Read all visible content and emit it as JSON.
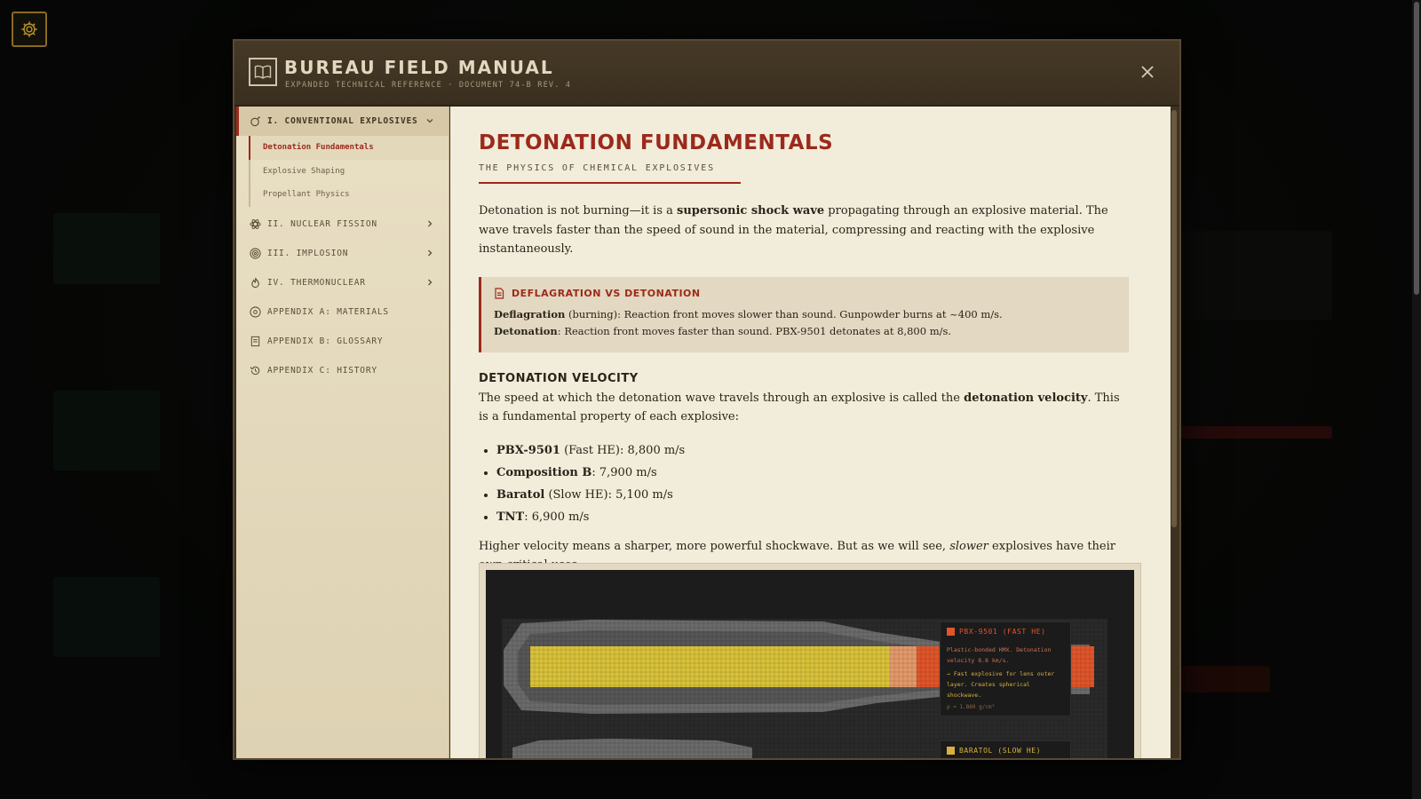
{
  "modal": {
    "title": "BUREAU FIELD MANUAL",
    "subtitle": "EXPANDED TECHNICAL REFERENCE · DOCUMENT 74-B REV. 4"
  },
  "sidebar": {
    "sections": [
      {
        "label": "I. CONVENTIONAL EXPLOSIVES",
        "icon": "bomb-icon",
        "expanded": true,
        "items": [
          "Detonation Fundamentals",
          "Explosive Shaping",
          "Propellant Physics"
        ]
      },
      {
        "label": "II. NUCLEAR FISSION",
        "icon": "atom-icon"
      },
      {
        "label": "III. IMPLOSION",
        "icon": "target-icon"
      },
      {
        "label": "IV. THERMONUCLEAR",
        "icon": "flame-icon"
      },
      {
        "label": "APPENDIX A: MATERIALS",
        "icon": "materials-icon"
      },
      {
        "label": "APPENDIX B: GLOSSARY",
        "icon": "glossary-icon"
      },
      {
        "label": "APPENDIX C: HISTORY",
        "icon": "history-icon"
      }
    ]
  },
  "content": {
    "title": "DETONATION FUNDAMENTALS",
    "subtitle": "THE PHYSICS OF CHEMICAL EXPLOSIVES",
    "intro_a": "Detonation is not burning—it is a ",
    "intro_b": "supersonic shock wave",
    "intro_c": " propagating through an explosive material. The wave travels faster than the speed of sound in the material, compressing and reacting with the explosive instantaneously.",
    "callout": {
      "title": "DEFLAGRATION VS DETONATION",
      "line1_term": "Deflagration",
      "line1_text": " (burning): Reaction front moves slower than sound. Gunpowder burns at ~400 m/s.",
      "line2_term": "Detonation",
      "line2_text": ": Reaction front moves faster than sound. PBX-9501 detonates at 8,800 m/s."
    },
    "velocity_heading": "DETONATION VELOCITY",
    "velocity_a": "The speed at which the detonation wave travels through an explosive is called the ",
    "velocity_b": "detonation velocity",
    "velocity_c": ". This is a fundamental property of each explosive:",
    "velocities": [
      {
        "name": "PBX-9501",
        "text": " (Fast HE): 8,800 m/s"
      },
      {
        "name": "Composition B",
        "text": ": 7,900 m/s"
      },
      {
        "name": "Baratol",
        "text": " (Slow HE): 5,100 m/s"
      },
      {
        "name": "TNT",
        "text": ": 6,900 m/s"
      }
    ],
    "closing_a": "Higher velocity means a sharper, more powerful shockwave. But as we will see, ",
    "closing_b": "slower",
    "closing_c": " explosives have their own critical uses."
  },
  "visualization": {
    "legend1": {
      "title": "PBX-9501 (FAST HE)",
      "color": "#e0552a",
      "desc1": "Plastic-bonded HMX. Detonation",
      "desc2": "velocity 8.8 km/s.",
      "note1": "→ Fast explosive for lens outer",
      "note2": "layer. Creates spherical shockwave.",
      "density": "ρ = 1.860 g/cm³"
    },
    "legend2": {
      "title": "BARATOL (SLOW HE)",
      "color": "#d9b040"
    },
    "colors": {
      "core": "#d9c23a",
      "shell": "#6a6a6a",
      "front": "#e0552a"
    }
  }
}
